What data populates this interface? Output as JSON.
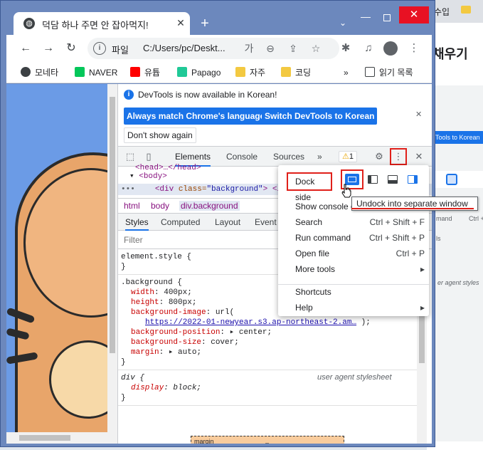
{
  "background_window": {
    "tab_text": "수입",
    "heading": "채우기",
    "switch_button": "Tools to Korean",
    "shortcut_text": "Ctrl + Sh",
    "command_text": "mand",
    "list_fragment": "ls",
    "stylesheet_text": "er agent styles"
  },
  "tab": {
    "title": "덕담 하나 주면 안 잡아먹지!",
    "close": "✕",
    "new_tab": "+",
    "search_tabs": "⌄"
  },
  "window_controls": {
    "minimize": "—",
    "close": "✕"
  },
  "toolbar": {
    "back": "←",
    "forward": "→",
    "reload": "↻",
    "site_info": "i",
    "scheme_label": "파일",
    "url": "C:/Users/pc/Deskt...",
    "translate_icon": "가",
    "zoom_icon": "⊖",
    "share_icon": "⇪",
    "star_icon": "☆",
    "extensions_icon": "✱",
    "media_icon": "♫",
    "menu_icon": "⋮"
  },
  "bookmarks": [
    {
      "label": "모네타",
      "icon_color": "#3c4043"
    },
    {
      "label": "NAVER",
      "icon_color": "#03c75a"
    },
    {
      "label": "유튭",
      "icon_color": "#ff0000"
    },
    {
      "label": "Papago",
      "icon_color": "#20c997"
    },
    {
      "label": "자주",
      "icon_color": "#f3c941"
    },
    {
      "label": "코딩",
      "icon_color": "#f3c941"
    }
  ],
  "bookmarks_more": "»",
  "reading_list": "읽기 목록",
  "devtools": {
    "info_message": "DevTools is now available in Korean!",
    "btn_match": "Always match Chrome's language",
    "btn_switch": "Switch DevTools to Korean",
    "btn_dont_show": "Don't show again",
    "info_close": "✕",
    "tabs": {
      "elements": "Elements",
      "console": "Console",
      "sources": "Sources",
      "more": "»"
    },
    "warnings": "1",
    "warning_icon": "⚠",
    "gear_icon": "⚙",
    "kebab_icon": "⋮",
    "close_icon": "✕",
    "dom": {
      "line1": "<head>…</head>",
      "line2_tag": "<body>",
      "line3_dots": "•••",
      "line3_open": "<div",
      "line3_attr": " class=",
      "line3_val": "\"background\"",
      "line3_close": "> </d"
    },
    "breadcrumbs": [
      "html",
      "body",
      "div.background"
    ],
    "subtabs": [
      "Styles",
      "Computed",
      "Layout",
      "Event l"
    ],
    "filter_placeholder": "Filter",
    "styles": {
      "element_style": "element.style {",
      "close_brace": "}",
      "bg_selector": ".background {",
      "width_prop": "width",
      "width_val": "400px;",
      "height_prop": "height",
      "height_val": "800px;",
      "bgimg_prop": "background-image",
      "bgimg_val": "url(",
      "bgimg_link": "https://2022-01-newyear.s3.ap-northeast-2.am…",
      "bgimg_end": ");",
      "bgpos_prop": "background-position",
      "bgpos_val": "▸ center;",
      "bgsize_prop": "background-size",
      "bgsize_val": "cover;",
      "margin_prop": "margin",
      "margin_val": "▸ auto;",
      "div_selector": "div {",
      "div_source": "user agent stylesheet",
      "display_prop": "display",
      "display_val": "block;",
      "box_label": "margin",
      "box_dash": "–"
    }
  },
  "menu": {
    "dock_side": "Dock side",
    "items": [
      {
        "label": "Show console d",
        "shortcut": ""
      },
      {
        "label": "Search",
        "shortcut": "Ctrl + Shift + F"
      },
      {
        "label": "Run command",
        "shortcut": "Ctrl + Shift + P"
      },
      {
        "label": "Open file",
        "shortcut": "Ctrl + P"
      },
      {
        "label": "More tools",
        "shortcut": "▸"
      },
      {
        "label": "Shortcuts",
        "shortcut": ""
      },
      {
        "label": "Help",
        "shortcut": "▸"
      }
    ]
  },
  "tooltip": "Undock into separate window"
}
